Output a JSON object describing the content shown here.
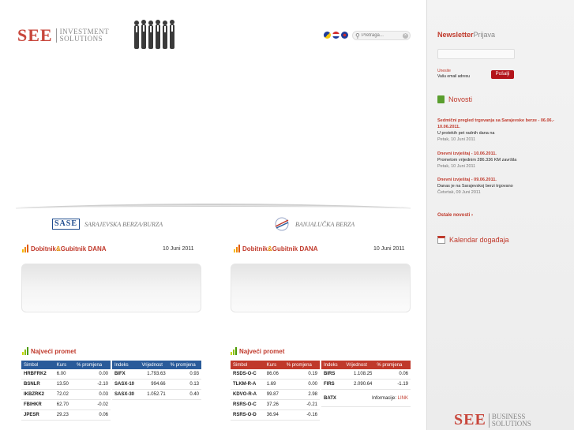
{
  "header": {
    "logo_mark": "SEE",
    "logo_line1": "INVESTMENT",
    "logo_line2": "SOLUTIONS",
    "search_placeholder": "Pretraga..."
  },
  "exchanges": {
    "left": {
      "code": "SASE",
      "name": "SARAJEVSKA BERZA/BURZA"
    },
    "right": {
      "name": "BANJALUČKA BERZA"
    }
  },
  "panels": {
    "winners_title_a": "Dobitnik",
    "winners_amp": "&",
    "winners_title_b": "Gubitnik DANA",
    "date": "10 Juni 2011",
    "turnover_title": "Najveći promet"
  },
  "sa": {
    "stocks_headers": [
      "Simbol",
      "Kurs",
      "% promjena"
    ],
    "stocks": [
      [
        "HRBFRK2",
        "6.00",
        "0.00"
      ],
      [
        "BSNLR",
        "13.50",
        "-2.10"
      ],
      [
        "IKBZRK2",
        "72.02",
        "0.03"
      ],
      [
        "FBIHKR",
        "62.70",
        "-0.02"
      ],
      [
        "JPESR",
        "29.23",
        "0.06"
      ]
    ],
    "index_headers": [
      "Indeks",
      "Vrijednost",
      "% promjena"
    ],
    "indices": [
      [
        "BIFX",
        "1.793.63",
        "0.93"
      ],
      [
        "SASX-10",
        "994.66",
        "0.13"
      ],
      [
        "SASX-30",
        "1.052.71",
        "0.40"
      ]
    ]
  },
  "bl": {
    "stocks_headers": [
      "Simbol",
      "Kurs",
      "% promjena"
    ],
    "stocks": [
      [
        "RSDS-O-C",
        "86.06",
        "0.19"
      ],
      [
        "TLKM-R-A",
        "1.69",
        "0.00"
      ],
      [
        "KDVO-R-A",
        "99.87",
        "2.98"
      ],
      [
        "RSRS-O-C",
        "37.26",
        "-0.21"
      ],
      [
        "RSRS-O-D",
        "36.94",
        "-0.16"
      ]
    ],
    "index_headers": [
      "Indeks",
      "Vrijednost",
      "% promjena"
    ],
    "indices": [
      [
        "BIRS",
        "1.108.25",
        "0.06"
      ],
      [
        "FIRS",
        "2.090.64",
        "-1.19"
      ]
    ],
    "batx_label": "BATX",
    "batx_info": "Informacije:",
    "batx_link": "LINK"
  },
  "sidebar": {
    "newsletter_a": "Newsletter",
    "newsletter_b": "Prijava",
    "input_label_1": "Unesite",
    "input_label_2": "Vašu email adresu",
    "submit": "Pošalji",
    "news_title": "Novosti",
    "news": [
      {
        "title": "Sedmični pregled trgovanja sa Sarajevske berze - 06.06.- 10.06.2011.",
        "body": "U protekih pet radnih dana na",
        "date": "Petak, 10 Juni 2011"
      },
      {
        "title": "Dnevni izvještaj - 10.06.2011.",
        "body": "Prometom vrijednim 286.336 KM završila",
        "date": "Petak, 10 Juni 2011"
      },
      {
        "title": "Dnevni izvještaj - 09.06.2011.",
        "body": "Danas je na Sarajevskoj berzi trgovano",
        "date": "Četvrtak, 09 Juni 2011"
      }
    ],
    "more": "Ostale novosti ›",
    "calendar_title": "Kalendar događaja",
    "footer_mark": "SEE",
    "footer_line1": "BUSINESS",
    "footer_line2": "SOLUTIONS"
  },
  "colors": {
    "brand_red": "#c8473c",
    "accent_red": "#c0392b",
    "table_blue": "#2a5b9a",
    "button_red": "#b3141b"
  }
}
